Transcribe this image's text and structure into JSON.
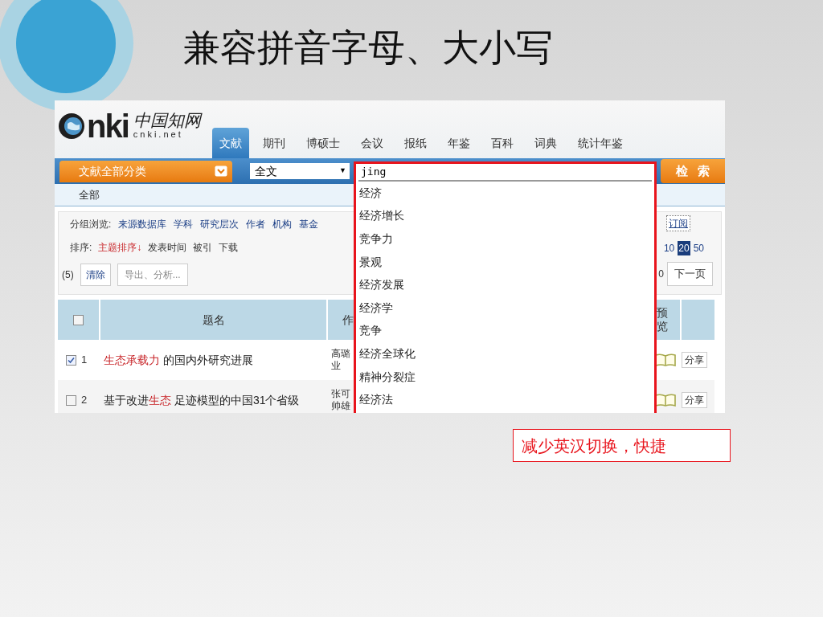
{
  "slide_title": "兼容拼音字母、大小写",
  "logo": {
    "wordmark": "nki",
    "chinese": "中国知网",
    "domain": "cnki.net"
  },
  "tabs": [
    {
      "label": "文献",
      "selected": true
    },
    {
      "label": "期刊",
      "selected": false
    },
    {
      "label": "博硕士",
      "selected": false
    },
    {
      "label": "会议",
      "selected": false
    },
    {
      "label": "报纸",
      "selected": false
    },
    {
      "label": "年鉴",
      "selected": false
    },
    {
      "label": "百科",
      "selected": false
    },
    {
      "label": "词典",
      "selected": false
    },
    {
      "label": "统计年鉴",
      "selected": false
    }
  ],
  "search": {
    "category_button": "文献全部分类",
    "field_select": "全文",
    "field_caret": "▼",
    "query": "jing",
    "submit": "检 索"
  },
  "subcategory": "全部",
  "group_browse": {
    "label": "分组浏览:",
    "links": [
      "来源数据库",
      "学科",
      "研究层次",
      "作者",
      "机构",
      "基金"
    ],
    "subscribe": "订阅"
  },
  "sort": {
    "label": "排序:",
    "options": [
      {
        "label": "主题排序↓",
        "selected": true
      },
      {
        "label": "发表时间",
        "selected": false
      },
      {
        "label": "被引",
        "selected": false
      },
      {
        "label": "下载",
        "selected": false
      }
    ]
  },
  "page_sizes": [
    {
      "label": "10",
      "selected": false
    },
    {
      "label": "20",
      "selected": true
    },
    {
      "label": "50",
      "selected": false
    }
  ],
  "actions": {
    "count": "(5)",
    "clear": "清除",
    "export": "导出、分析...",
    "page_fragment": "0",
    "next": "下一页"
  },
  "table": {
    "columns": [
      "题名",
      "作",
      "预览"
    ],
    "header_checked": false,
    "rows": [
      {
        "checked": true,
        "index": "1",
        "title": [
          {
            "text": "生态承载力",
            "highlight": true
          },
          {
            "text": " 的国内外研究进展",
            "highlight": false
          }
        ],
        "author": [
          "高璐",
          "业"
        ],
        "share": "分享"
      },
      {
        "checked": false,
        "index": "2",
        "title": [
          {
            "text": "基于改进",
            "highlight": false
          },
          {
            "text": "生态",
            "highlight": true
          },
          {
            "text": " 足迹模型的中国31个省级",
            "highlight": false
          }
        ],
        "author": [
          "张可",
          "帅雄"
        ],
        "share": "分享"
      }
    ]
  },
  "suggestions": [
    "经济",
    "经济增长",
    "竞争力",
    "景观",
    "经济发展",
    "经济学",
    "竞争",
    "经济全球化",
    "精神分裂症",
    "经济法"
  ],
  "caption": "减少英汉切换，快捷"
}
